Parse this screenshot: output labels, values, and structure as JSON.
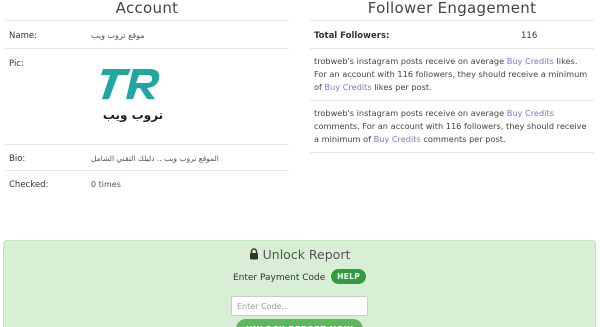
{
  "account": {
    "title": "Account",
    "name_label": "Name:",
    "name_value": "موقع تروب ويب",
    "pic_label": "Pic:",
    "logo_arabic": "تروب ويب",
    "bio_label": "Bio:",
    "bio_value": "الموقع تروب ويب .. دليلك التقني الشامل",
    "checked_label": "Checked:",
    "checked_value": "0 times"
  },
  "engagement": {
    "title": "Follower Engagement",
    "total_label": "Total Followers:",
    "total_value": "116",
    "likes": {
      "p1": "trobweb's instagram posts receive on average ",
      "link1": "Buy Credits",
      "p2": " likes. For an account with 116 followers, they should receive a minimum of ",
      "link2": "Buy Credits",
      "p3": " likes per post."
    },
    "comments": {
      "p1": "trobweb's instagram posts receive on average ",
      "link1": "Buy Credits",
      "p2": " comments. For an account with 116 followers, they should receive a minimum of ",
      "link2": "Buy Credits",
      "p3": " comments per post."
    }
  },
  "unlock": {
    "title": "Unlock Report",
    "payment_label": "Enter Payment Code",
    "help_label": "HELP",
    "input_placeholder": "Enter Code...",
    "button_label": "UNLOCK REPORT NOW"
  },
  "colors": {
    "link": "#8e6cd8",
    "panel_bg": "#d8efd6",
    "help_bg": "#2f9d3f",
    "button_bg": "#5cb85c",
    "logo_teal": "#1fa7a0"
  },
  "icons": {
    "lock": "lock-icon"
  }
}
